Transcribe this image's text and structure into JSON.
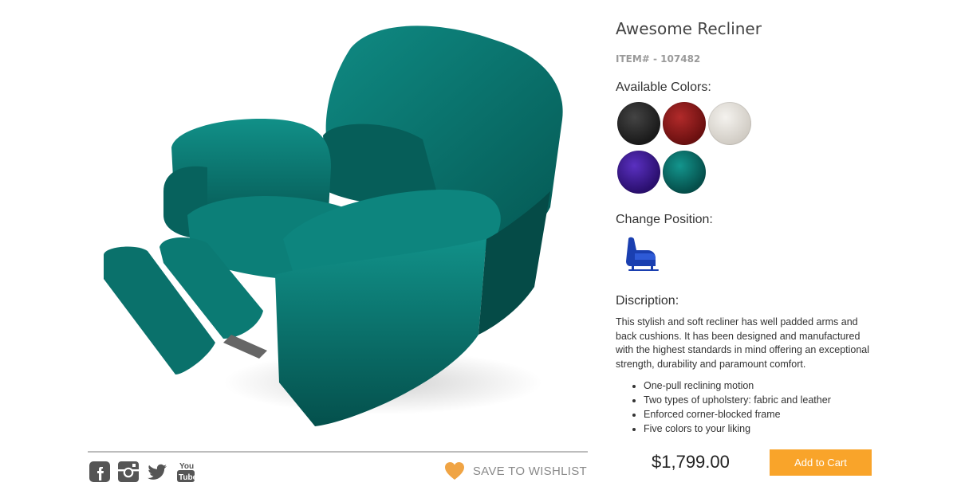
{
  "product": {
    "title": "Awesome Recliner",
    "item_number": "ITEM# - 107482",
    "image_name": "teal-recliner-render"
  },
  "colors": {
    "heading": "Available Colors:",
    "swatches": [
      {
        "name": "black",
        "hex": "#222222"
      },
      {
        "name": "red",
        "hex": "#8b1a1a"
      },
      {
        "name": "white",
        "hex": "#e6e2dc"
      },
      {
        "name": "purple",
        "hex": "#3d1a8c"
      },
      {
        "name": "teal",
        "hex": "#0a6b66"
      }
    ],
    "selected": "teal"
  },
  "position": {
    "heading": "Change Position:",
    "icon": "recliner-upright-icon",
    "icon_color": "#1a3fb0"
  },
  "description": {
    "heading": "Discription:",
    "text": "This stylish and soft recliner has well padded arms and back cushions. It has been designed and manufactured with the highest standards in mind offering an exceptional strength, durability and paramount comfort.",
    "features": [
      "One-pull reclining motion",
      "Two types of upholstery: fabric and leather",
      "Enforced corner-blocked frame",
      "Five colors to your liking"
    ]
  },
  "purchase": {
    "price": "$1,799.00",
    "cart_label": "Add to Cart",
    "cart_color": "#f9a42a"
  },
  "wishlist": {
    "label": "SAVE TO WISHLIST",
    "icon": "heart-icon",
    "icon_color": "#f0a444"
  },
  "social": [
    "facebook-icon",
    "instagram-icon",
    "twitter-icon",
    "youtube-icon"
  ]
}
